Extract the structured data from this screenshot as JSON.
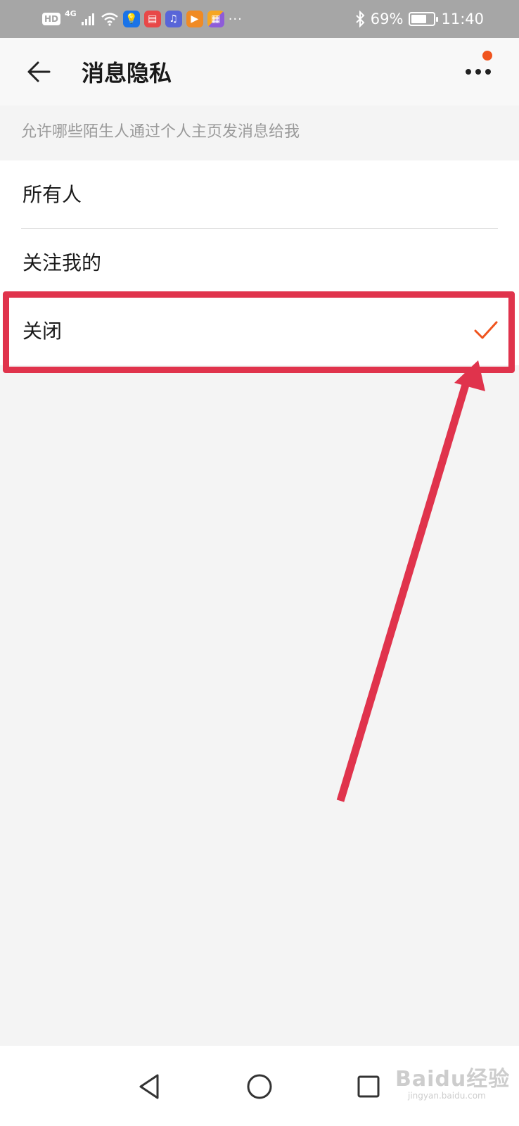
{
  "status_bar": {
    "hd": "HD",
    "network": "4G",
    "battery_percent": "69%",
    "battery_level": 0.69,
    "time": "11:40",
    "more_notifications": "···"
  },
  "header": {
    "title": "消息隐私"
  },
  "section": {
    "description": "允许哪些陌生人通过个人主页发消息给我"
  },
  "options": [
    {
      "label": "所有人",
      "selected": false
    },
    {
      "label": "关注我的",
      "selected": false
    },
    {
      "label": "关闭",
      "selected": true
    }
  ],
  "colors": {
    "accent": "#f0541e",
    "annotation": "#e0334c",
    "status_bar_bg": "#a6a6a6"
  },
  "watermark": {
    "brand": "Baidu经验",
    "url": "jingyan.baidu.com"
  }
}
